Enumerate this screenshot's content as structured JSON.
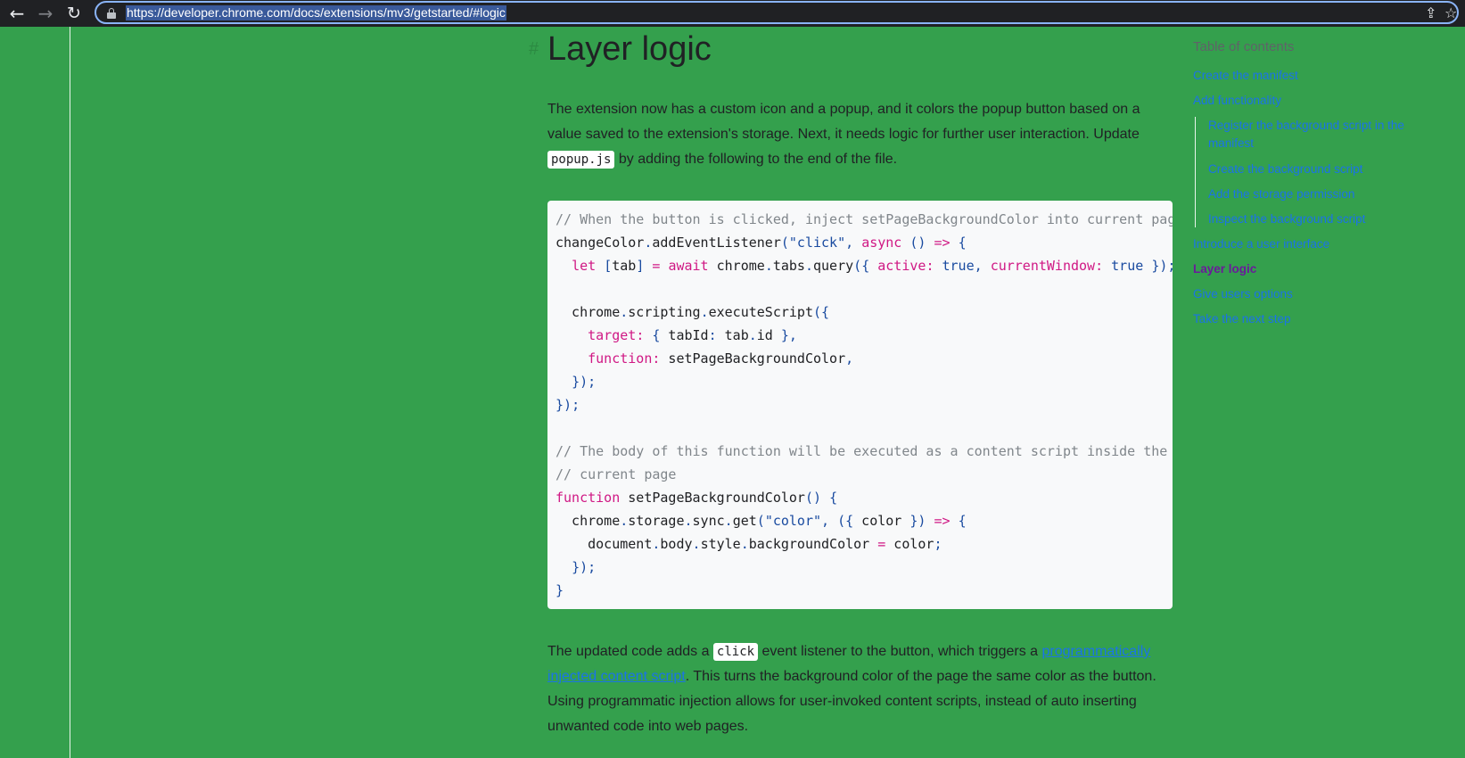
{
  "browser": {
    "url": "https://developer.chrome.com/docs/extensions/mv3/getstarted/#logic",
    "icons": [
      "back-arrow-icon",
      "forward-arrow-icon",
      "reload-icon",
      "lock-icon",
      "share-icon",
      "star-icon"
    ]
  },
  "article": {
    "heading_anchor": "#",
    "heading": "Layer logic",
    "p1_before": "The extension now has a custom icon and a popup, and it colors the popup button based on a value saved to the extension's storage. Next, it needs logic for further user interaction. Update ",
    "p1_code": "popup.js",
    "p1_after": " by adding the following to the end of the file.",
    "code_lines": [
      "// When the button is clicked, inject setPageBackgroundColor into current page",
      "changeColor.addEventListener(\"click\", async () => {",
      "  let [tab] = await chrome.tabs.query({ active: true, currentWindow: true });",
      "",
      "  chrome.scripting.executeScript({",
      "    target: { tabId: tab.id },",
      "    function: setPageBackgroundColor,",
      "  });",
      "});",
      "",
      "// The body of this function will be executed as a content script inside the",
      "// current page",
      "function setPageBackgroundColor() {",
      "  chrome.storage.sync.get(\"color\", ({ color }) => {",
      "    document.body.style.backgroundColor = color;",
      "  });",
      "}"
    ],
    "p2_before": "The updated code adds a ",
    "p2_code": "click",
    "p2_mid": " event listener to the button, which triggers a ",
    "p2_link": "programmatically injected content script",
    "p2_after": ". This turns the background color of the page the same color as the button. Using programmatic injection allows for user-invoked content scripts, instead of auto inserting unwanted code into web pages."
  },
  "toc": {
    "title": "Table of contents",
    "items": [
      {
        "label": "Create the manifest"
      },
      {
        "label": "Add functionality"
      },
      {
        "label": "Register the background script in the manifest"
      },
      {
        "label": "Create the background script"
      },
      {
        "label": "Add the storage permission"
      },
      {
        "label": "Inspect the background script"
      },
      {
        "label": "Introduce a user interface"
      },
      {
        "label": "Layer logic"
      },
      {
        "label": "Give users options"
      },
      {
        "label": "Take the next step"
      }
    ]
  },
  "colors": {
    "page_background": "#34a04d",
    "link": "#1a73e8",
    "toc_active": "#6a1b9a"
  }
}
